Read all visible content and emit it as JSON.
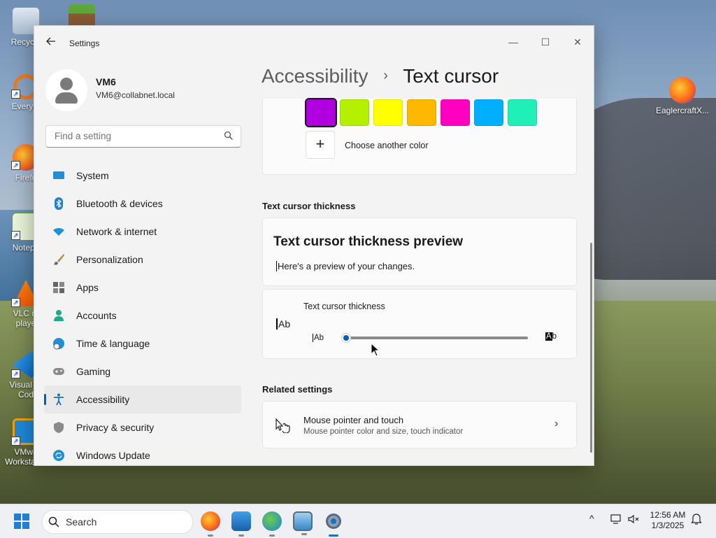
{
  "desktop": {
    "icons": [
      {
        "label": "Recycle",
        "icon": "recycle-bin-icon"
      },
      {
        "label": "Everyth",
        "icon": "everything-search-icon"
      },
      {
        "label": "Firefo",
        "icon": "firefox-icon"
      },
      {
        "label": "Notepa",
        "icon": "notepad-icon"
      },
      {
        "label": "VLC m",
        "label2": "playe",
        "icon": "vlc-icon"
      },
      {
        "label": "Visual St",
        "label2": "Cod",
        "icon": "vscode-icon"
      },
      {
        "label": "VMwa",
        "label2": "Workstati...",
        "icon": "vmware-icon"
      },
      {
        "label": "EaglercraftX...",
        "icon": "eaglercraft-icon"
      }
    ]
  },
  "window": {
    "title": "Settings",
    "back_icon": "arrow-left-icon",
    "controls": {
      "minimize": "—",
      "maximize": "☐",
      "close": "✕"
    }
  },
  "profile": {
    "name": "VM6",
    "email": "VM6@collabnet.local"
  },
  "search": {
    "placeholder": "Find a setting"
  },
  "nav": {
    "items": [
      {
        "label": "System",
        "icon": "system-display-icon"
      },
      {
        "label": "Bluetooth & devices",
        "icon": "bluetooth-icon"
      },
      {
        "label": "Network & internet",
        "icon": "wifi-icon"
      },
      {
        "label": "Personalization",
        "icon": "paintbrush-icon"
      },
      {
        "label": "Apps",
        "icon": "apps-grid-icon"
      },
      {
        "label": "Accounts",
        "icon": "accounts-person-icon"
      },
      {
        "label": "Time & language",
        "icon": "globe-clock-icon"
      },
      {
        "label": "Gaming",
        "icon": "gamepad-icon"
      },
      {
        "label": "Accessibility",
        "icon": "accessibility-icon",
        "active": true
      },
      {
        "label": "Privacy & security",
        "icon": "shield-icon"
      },
      {
        "label": "Windows Update",
        "icon": "update-sync-icon"
      }
    ]
  },
  "breadcrumb": {
    "parent": "Accessibility",
    "separator": "›",
    "current": "Text cursor"
  },
  "colors": {
    "swatches": [
      "#b000e0",
      "#b4f000",
      "#ffff00",
      "#ffb800",
      "#ff00c0",
      "#00b0ff",
      "#20f0b8"
    ],
    "selected_index": 0,
    "accent": "#005fb8",
    "add_label": "Choose another color",
    "add_symbol": "+"
  },
  "thickness": {
    "section_title": "Text cursor thickness",
    "preview_title": "Text cursor thickness preview",
    "preview_text": "Here's a preview of your changes.",
    "setting_label": "Text cursor thickness",
    "ab_big": "Ab",
    "ab_small": "Ab",
    "ab_large_a": "A",
    "ab_large_b": "b",
    "slider_value": 0.0
  },
  "related": {
    "section_title": "Related settings",
    "item_title": "Mouse pointer and touch",
    "item_subtitle": "Mouse pointer color and size, touch indicator",
    "item_icon": "mouse-pointer-hand-icon",
    "chevron": "›"
  },
  "taskbar": {
    "search_label": "Search",
    "apps": [
      "firefox-icon",
      "photos-icon",
      "network-globe-icon",
      "remote-desktop-icon",
      "settings-gear-icon"
    ],
    "tray_chevron": "^",
    "time": "12:56 AM",
    "date": "1/3/2025"
  }
}
